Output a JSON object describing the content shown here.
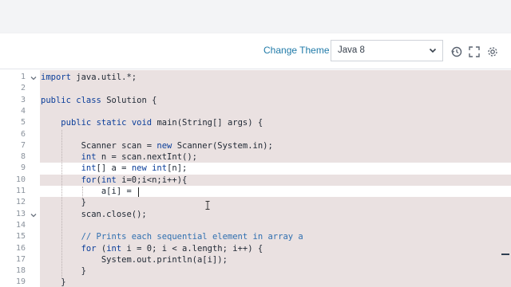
{
  "toolbar": {
    "change_theme_label": "Change Theme",
    "language_value": "Java 8"
  },
  "icons": {
    "language_dropdown": "chevron-down-icon",
    "restore": "history-icon",
    "fullscreen": "expand-icon",
    "settings": "gear-icon"
  },
  "editor": {
    "active_line": 11,
    "lines": [
      {
        "n": "1",
        "fold": true,
        "code": "import java.util.*;"
      },
      {
        "n": "2",
        "fold": false,
        "code": ""
      },
      {
        "n": "3",
        "fold": false,
        "code": "public class Solution {"
      },
      {
        "n": "4",
        "fold": false,
        "code": ""
      },
      {
        "n": "5",
        "fold": false,
        "code": "    public static void main(String[] args) {"
      },
      {
        "n": "6",
        "fold": false,
        "code": ""
      },
      {
        "n": "7",
        "fold": false,
        "code": "        Scanner scan = new Scanner(System.in);"
      },
      {
        "n": "8",
        "fold": false,
        "code": "        int n = scan.nextInt();"
      },
      {
        "n": "9",
        "fold": false,
        "code": "        int[] a = new int[n];"
      },
      {
        "n": "10",
        "fold": false,
        "code": "        for(int i=0;i<n;i++){"
      },
      {
        "n": "11",
        "fold": false,
        "code": "            a[i] = "
      },
      {
        "n": "12",
        "fold": false,
        "code": "        }"
      },
      {
        "n": "13",
        "fold": true,
        "code": "        scan.close();"
      },
      {
        "n": "14",
        "fold": false,
        "code": ""
      },
      {
        "n": "15",
        "fold": false,
        "code": "        // Prints each sequential element in array a"
      },
      {
        "n": "16",
        "fold": false,
        "code": "        for (int i = 0; i < a.length; i++) {"
      },
      {
        "n": "17",
        "fold": false,
        "code": "            System.out.println(a[i]);"
      },
      {
        "n": "18",
        "fold": false,
        "code": "        }"
      },
      {
        "n": "19",
        "fold": false,
        "code": "    }"
      }
    ]
  },
  "colors": {
    "accent": "#1f7aa8",
    "editor_bg": "#eae1e1",
    "keyword": "#0b3e9a",
    "comment": "#2f6fb0"
  }
}
